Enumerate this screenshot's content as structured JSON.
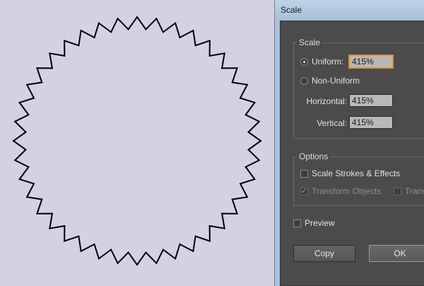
{
  "dialog": {
    "title": "Scale"
  },
  "scale_group": {
    "label": "Scale",
    "uniform": {
      "label": "Uniform:",
      "value": "415%",
      "selected": true
    },
    "non_uniform": {
      "label": "Non-Uniform",
      "selected": false
    },
    "horizontal": {
      "label": "Horizontal:",
      "value": "415%"
    },
    "vertical": {
      "label": "Vertical:",
      "value": "415%"
    }
  },
  "options_group": {
    "label": "Options",
    "scale_strokes": {
      "label": "Scale Strokes & Effects",
      "checked": false
    },
    "transform_objects": {
      "label": "Transform Objects",
      "checked": true,
      "enabled": false
    },
    "transform_patterns": {
      "label": "Trans",
      "checked": false,
      "enabled": false
    }
  },
  "preview": {
    "label": "Preview",
    "checked": false
  },
  "buttons": {
    "copy": "Copy",
    "ok": "OK"
  },
  "colors": {
    "canvas": "#d3d2e2",
    "panel": "#4b4b4b",
    "focus": "#e2902a",
    "stroke": "#000000"
  },
  "icons": {
    "shape": "zigzag-star-shape",
    "check": "checkmark-icon"
  }
}
